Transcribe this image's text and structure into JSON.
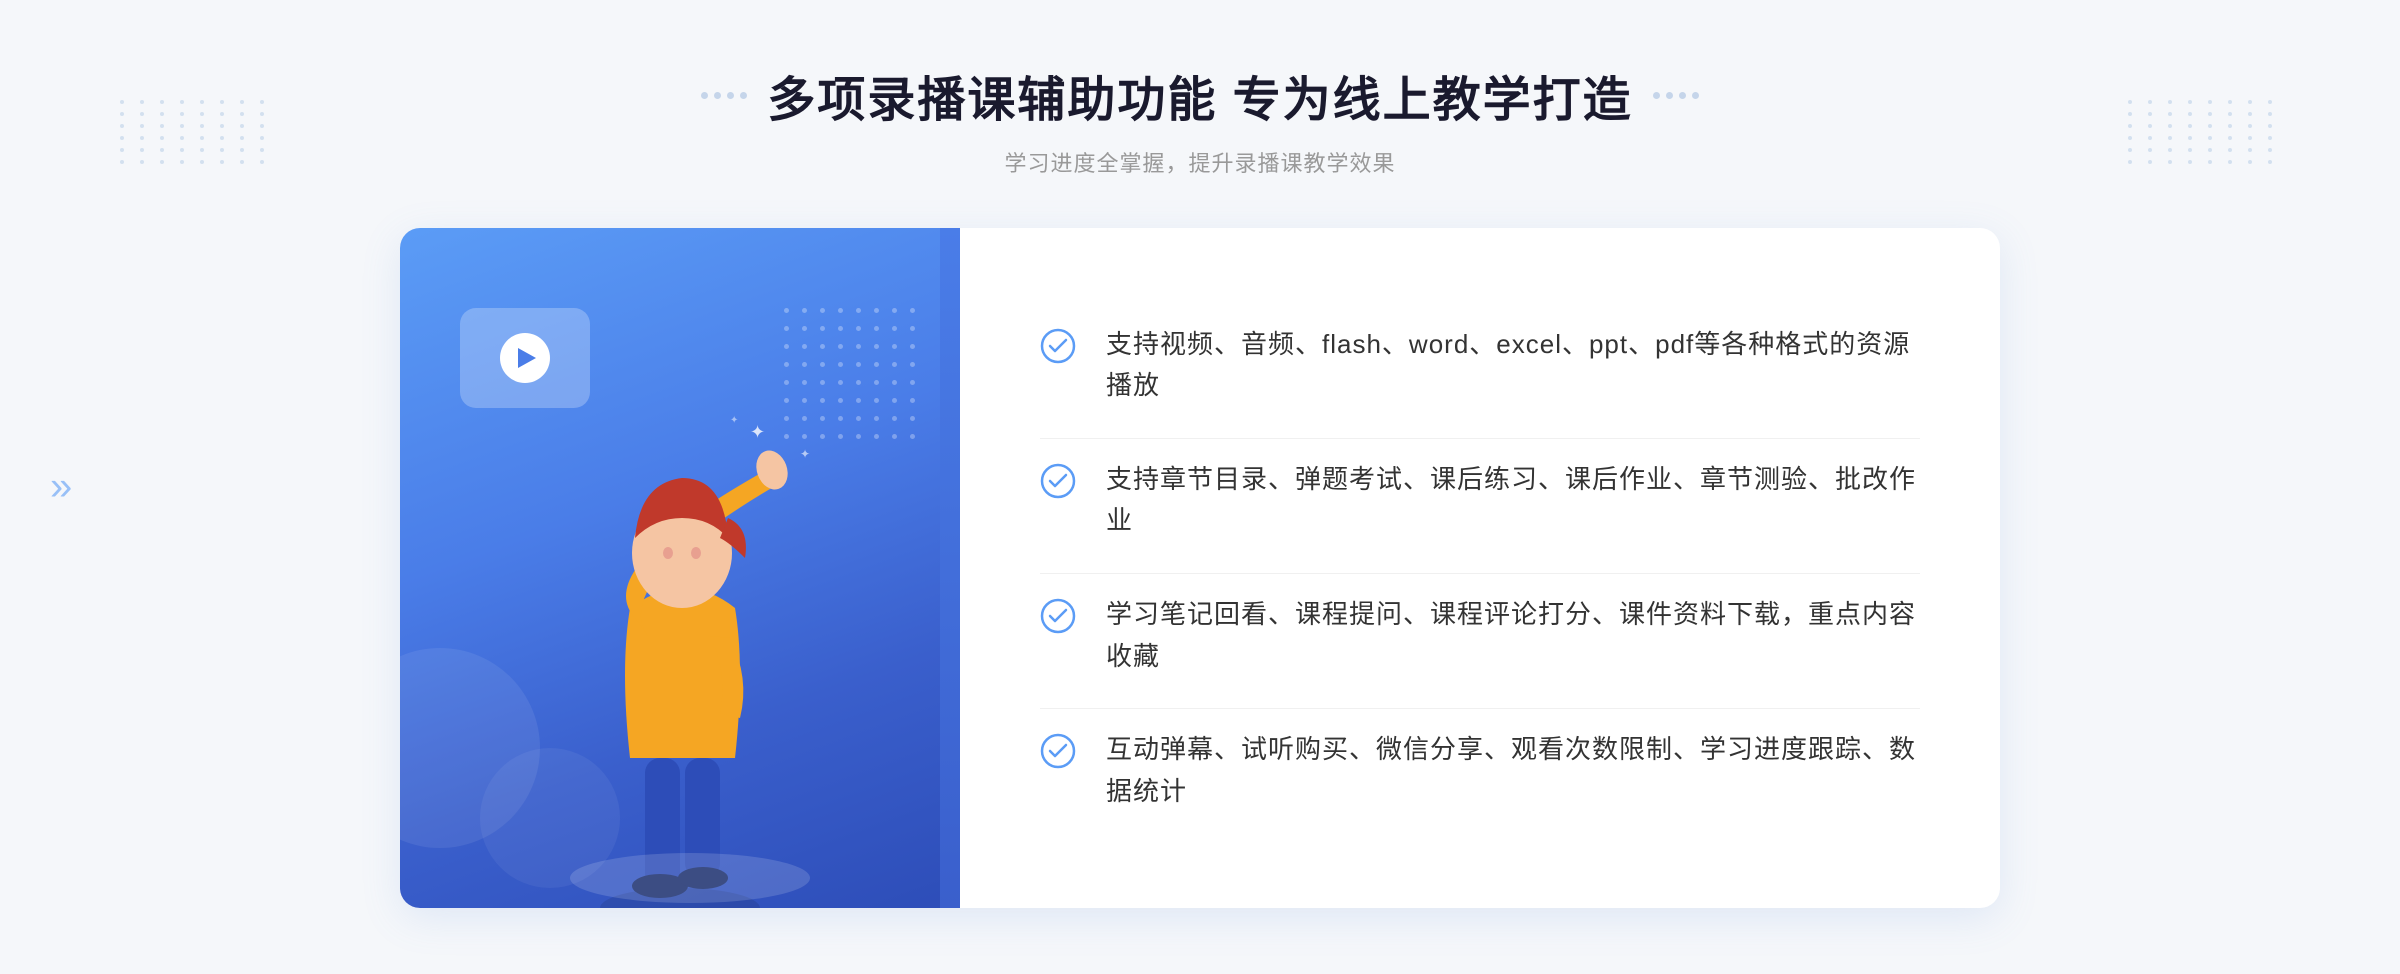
{
  "page": {
    "background_color": "#f5f7fa"
  },
  "header": {
    "title": "多项录播课辅助功能 专为线上教学打造",
    "subtitle": "学习进度全掌握，提升录播课教学效果"
  },
  "features": [
    {
      "id": 1,
      "text": "支持视频、音频、flash、word、excel、ppt、pdf等各种格式的资源播放"
    },
    {
      "id": 2,
      "text": "支持章节目录、弹题考试、课后练习、课后作业、章节测验、批改作业"
    },
    {
      "id": 3,
      "text": "学习笔记回看、课程提问、课程评论打分、课件资料下载，重点内容收藏"
    },
    {
      "id": 4,
      "text": "互动弹幕、试听购买、微信分享、观看次数限制、学习进度跟踪、数据统计"
    }
  ],
  "icons": {
    "check": "check-circle-icon",
    "play": "play-icon",
    "left_arrow": "chevron-left-icon"
  },
  "colors": {
    "primary_blue": "#4a7de8",
    "light_blue": "#5b9cf6",
    "dark_blue": "#3a5fcc",
    "text_dark": "#333333",
    "text_gray": "#999999",
    "check_color": "#5b9cf6"
  }
}
